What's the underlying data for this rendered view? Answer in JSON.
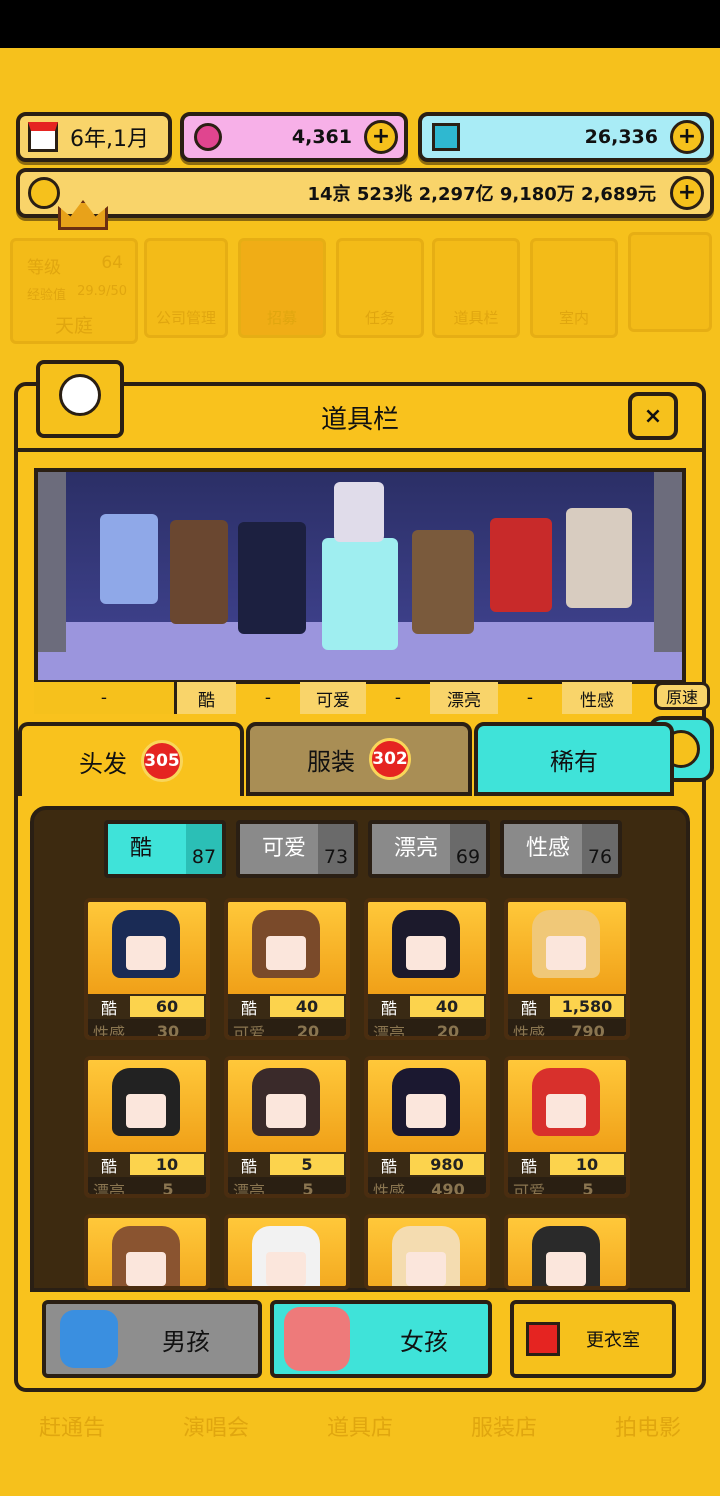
{
  "topbar": {
    "date": "6年,1月",
    "gems": "4,361",
    "diamonds": "26,336",
    "money": "14京 523兆 2,297亿 9,180万 2,689元"
  },
  "background_menu": {
    "level_label": "等级",
    "level_value": "64",
    "exp_label": "经验值",
    "exp_value": "29.9/50",
    "area": "天庭",
    "items": [
      "公司管理",
      "招募",
      "任务",
      "道具栏",
      "室内"
    ],
    "bottom_items": [
      "赶通告",
      "演唱会",
      "道具店",
      "服装店",
      "拍电影"
    ]
  },
  "dialog": {
    "title": "道具栏",
    "close": "×",
    "speed": "原速",
    "stat_labels": [
      "-",
      "酷",
      "-",
      "可爱",
      "-",
      "漂亮",
      "-",
      "性感"
    ],
    "tabs": [
      {
        "label": "头发",
        "count": "305"
      },
      {
        "label": "服装",
        "count": "302"
      },
      {
        "label": "稀有"
      }
    ],
    "filters": [
      {
        "label": "酷",
        "count": "87"
      },
      {
        "label": "可爱",
        "count": "73"
      },
      {
        "label": "漂亮",
        "count": "69"
      },
      {
        "label": "性感",
        "count": "76"
      }
    ],
    "items": [
      {
        "s1": "酷",
        "v1": "60",
        "s2": "性感",
        "v2": "30",
        "hair": "#1a2b55"
      },
      {
        "s1": "酷",
        "v1": "40",
        "s2": "可爱",
        "v2": "20",
        "hair": "#7a4a2a"
      },
      {
        "s1": "酷",
        "v1": "40",
        "s2": "漂亮",
        "v2": "20",
        "hair": "#1c1a2c"
      },
      {
        "s1": "酷",
        "v1": "1,580",
        "s2": "性感",
        "v2": "790",
        "hair": "#f0c878"
      },
      {
        "s1": "酷",
        "v1": "10",
        "s2": "漂亮",
        "v2": "5",
        "hair": "#222222"
      },
      {
        "s1": "酷",
        "v1": "5",
        "s2": "漂亮",
        "v2": "5",
        "hair": "#3a2a2a"
      },
      {
        "s1": "酷",
        "v1": "980",
        "s2": "性感",
        "v2": "490",
        "hair": "#1b1830"
      },
      {
        "s1": "酷",
        "v1": "10",
        "s2": "可爱",
        "v2": "5",
        "hair": "#d8302c"
      },
      {
        "hair": "#8a5430"
      },
      {
        "hair": "#f2f2f2"
      },
      {
        "hair": "#f4dcb0"
      },
      {
        "hair": "#2a2a2a"
      }
    ],
    "bottom": {
      "boy": "男孩",
      "girl": "女孩",
      "wardrobe": "更衣室"
    }
  },
  "colors": {
    "bg": "#f6c11c",
    "teal": "#3fe3d9",
    "pink": "#f7b0e8",
    "cyan": "#a9ecf6",
    "badge": "#e52421"
  }
}
